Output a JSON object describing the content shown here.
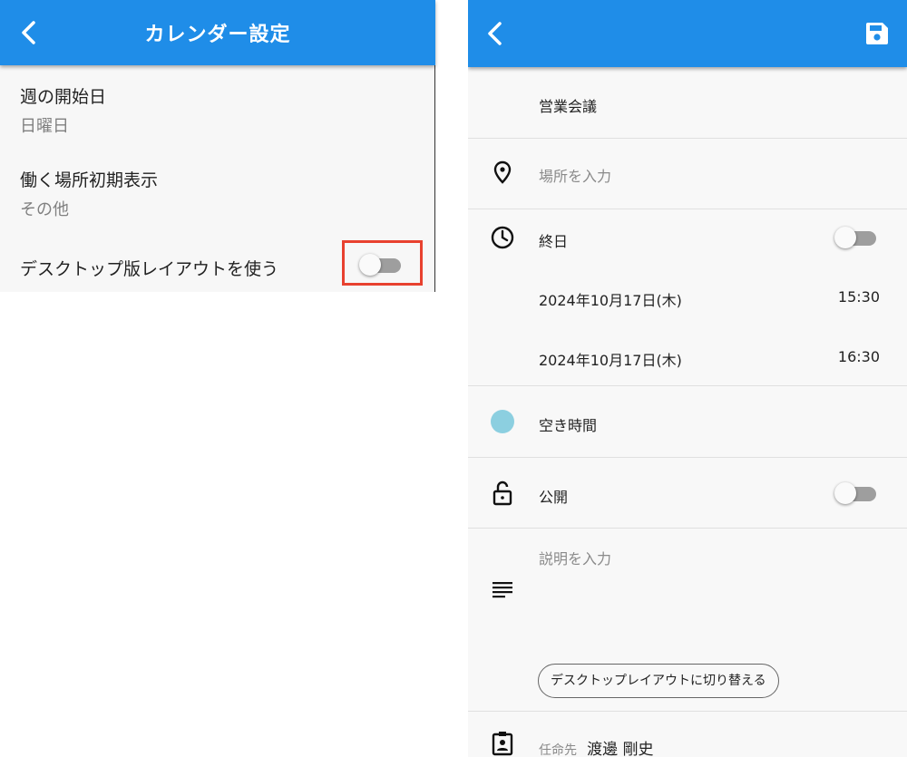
{
  "left_screen": {
    "title": "カレンダー設定",
    "items": [
      {
        "label": "週の開始日",
        "value": "日曜日"
      },
      {
        "label": "働く場所初期表示",
        "value": "その他"
      }
    ],
    "desktop_layout": {
      "label": "デスクトップ版レイアウトを使う",
      "enabled": false
    },
    "highlight_color": "#e8412f"
  },
  "right_screen": {
    "event_title": "営業会議",
    "location_placeholder": "場所を入力",
    "all_day": {
      "label": "終日",
      "enabled": false
    },
    "start": {
      "date": "2024年10月17日(木)",
      "time": "15:30"
    },
    "end": {
      "date": "2024年10月17日(木)",
      "time": "16:30"
    },
    "availability": {
      "label": "空き時間",
      "color": "#8ccfe0"
    },
    "visibility": {
      "label": "公開",
      "enabled": false
    },
    "description_placeholder": "説明を入力",
    "switch_layout_button": "デスクトップレイアウトに切り替える",
    "assignee": {
      "label": "任命先",
      "name": "渡邊 剛史"
    }
  },
  "colors": {
    "app_bar": "#1f8de8",
    "toggle_off": "#9e9e9e"
  },
  "icons": [
    "back-arrow-icon",
    "save-icon",
    "location-pin-icon",
    "clock-icon",
    "lock-open-icon",
    "description-lines-icon",
    "assignee-badge-icon"
  ]
}
